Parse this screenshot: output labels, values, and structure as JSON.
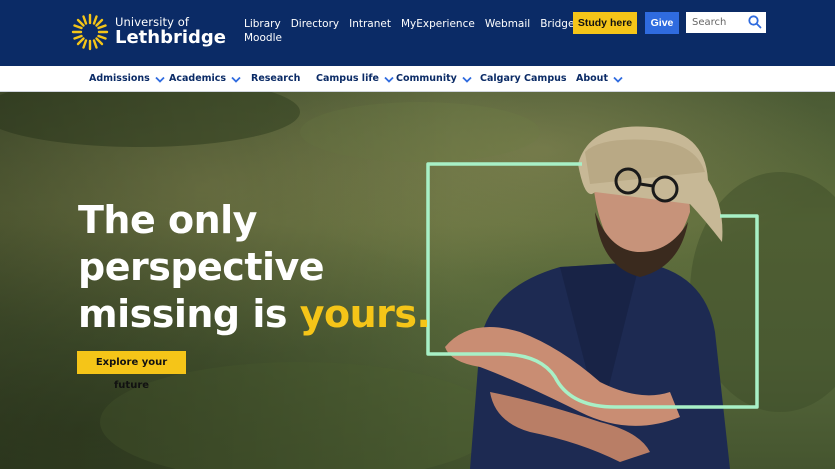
{
  "brand": {
    "line1": "University of",
    "line2": "Lethbridge",
    "accent_color": "#f5c518",
    "primary_color": "#0b2b66",
    "logo_icon": "sunburst-logo-icon"
  },
  "utility_links": [
    "Library",
    "Directory",
    "Intranet",
    "MyExperience",
    "Webmail",
    "Bridge",
    "Moodle"
  ],
  "header_buttons": {
    "study": "Study here",
    "give": "Give",
    "study_color": "#f5c518",
    "give_color": "#2f6bdf"
  },
  "search": {
    "placeholder": "Search",
    "icon": "search-icon"
  },
  "nav": {
    "items": [
      {
        "label": "Admissions",
        "has_dropdown": true
      },
      {
        "label": "Academics",
        "has_dropdown": true
      },
      {
        "label": "Research",
        "has_dropdown": false
      },
      {
        "label": "Campus life",
        "has_dropdown": true
      },
      {
        "label": "Community",
        "has_dropdown": true
      },
      {
        "label": "Calgary Campus",
        "has_dropdown": false
      },
      {
        "label": "About",
        "has_dropdown": true
      }
    ]
  },
  "hero": {
    "headline_line1": "The only",
    "headline_line2": "perspective",
    "headline_line3_prefix": "missing is ",
    "headline_line3_accent": "yours.",
    "cta_label": "Explore your future",
    "frame_color": "#a8f0c6"
  }
}
